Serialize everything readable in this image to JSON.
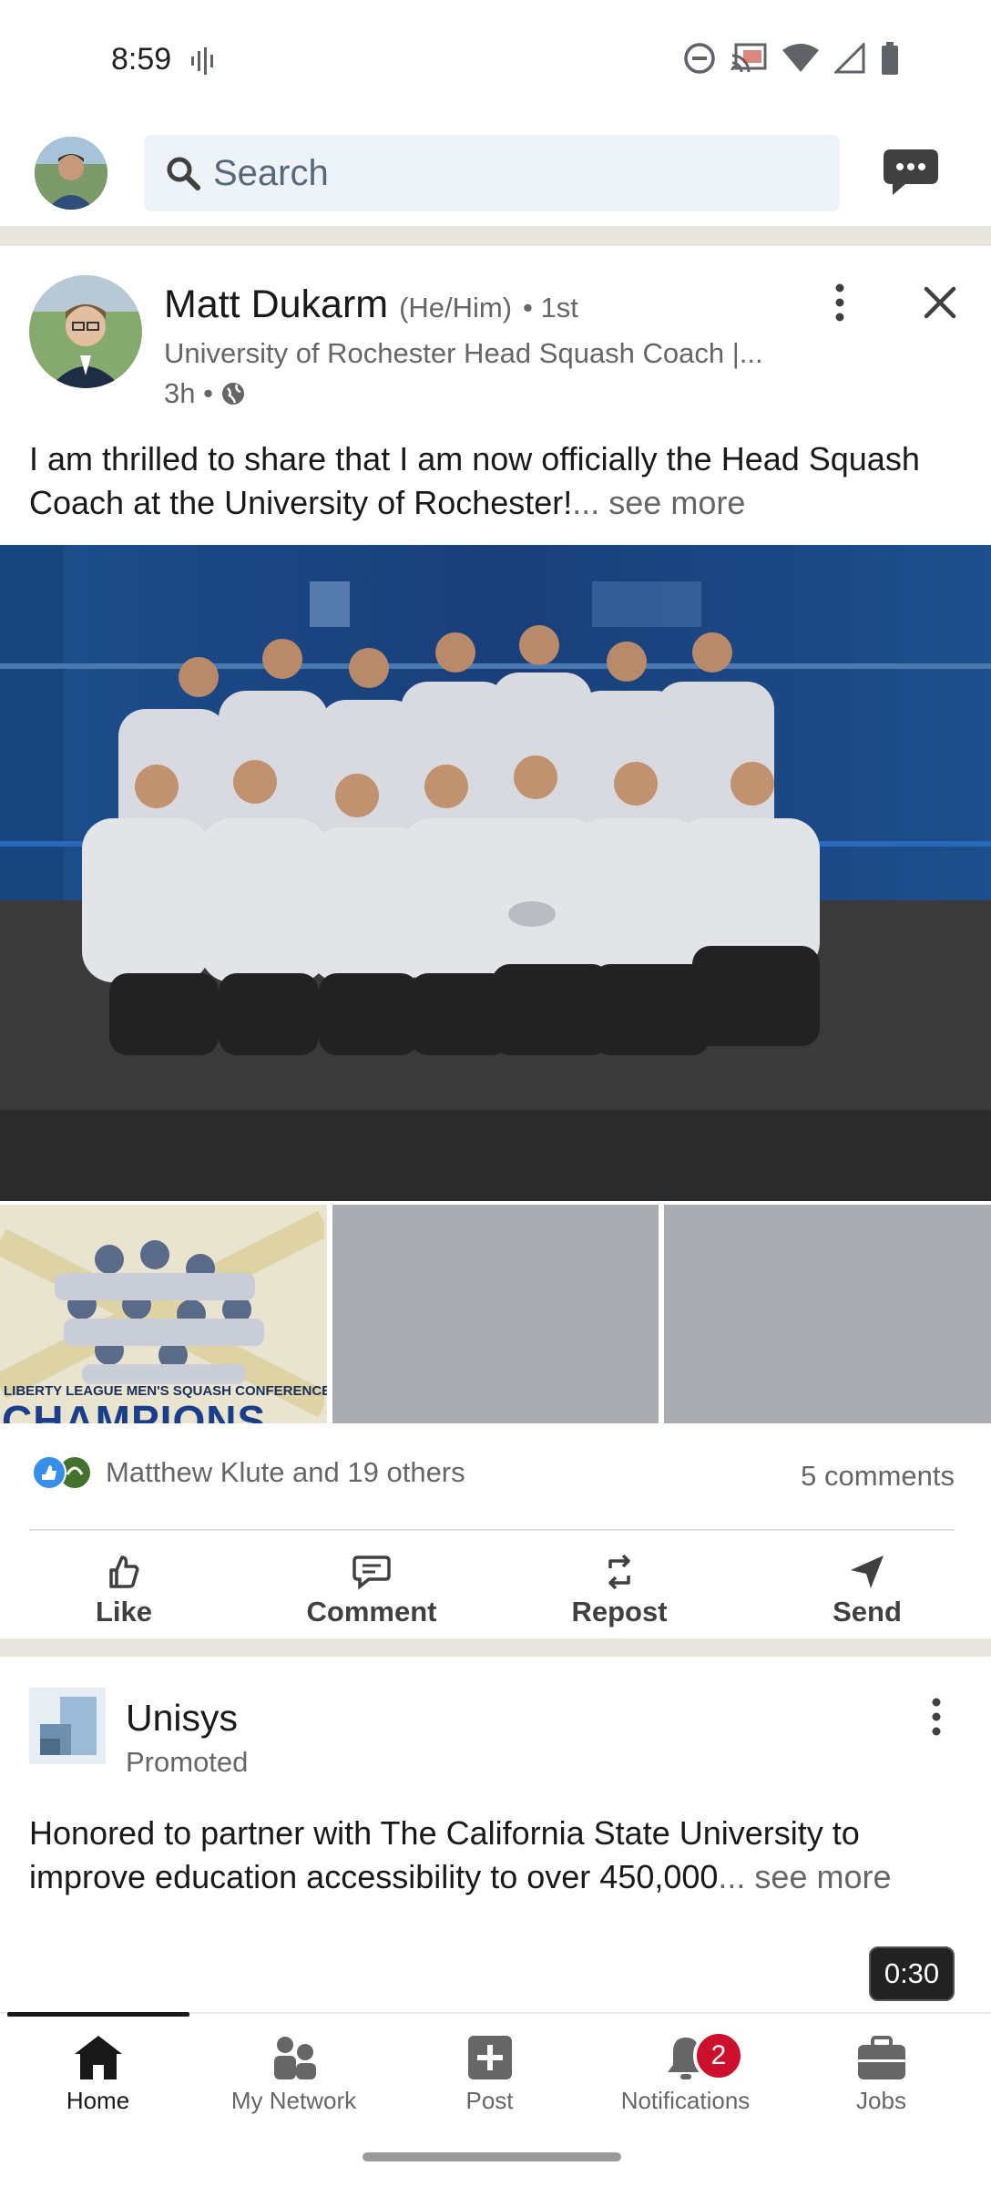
{
  "status": {
    "time": "8:59"
  },
  "search": {
    "placeholder": "Search"
  },
  "post1": {
    "author": "Matt Dukarm",
    "pronouns": "(He/Him)",
    "degree": "• 1st",
    "headline": "University of Rochester Head Squash Coach |...",
    "time": "3h •",
    "text_line1": "I am thrilled to share that I am now officially the Head Squash",
    "text_line2": "Coach at the University of Rochester!",
    "see_more": "... see more",
    "thumb_caption_1": "LIBERTY LEAGUE MEN'S SQUASH CONFERENCE",
    "thumb_caption_2": "CHAMPIONS",
    "reactions_text": "Matthew Klute and 19 others",
    "comments": "5 comments",
    "actions": [
      "Like",
      "Comment",
      "Repost",
      "Send"
    ]
  },
  "post2": {
    "company": "Unisys",
    "promoted": "Promoted",
    "text_line1": "Honored to partner with The California State University to",
    "text_line2": "improve education accessibility to over 450,000",
    "see_more": "... see more",
    "video_duration": "0:30"
  },
  "nav": {
    "items": [
      "Home",
      "My Network",
      "Post",
      "Notifications",
      "Jobs"
    ],
    "notifications_badge": "2"
  },
  "colors": {
    "accent": "#0a66c2",
    "badge": "#cb112d",
    "band": "#e9e5df"
  }
}
